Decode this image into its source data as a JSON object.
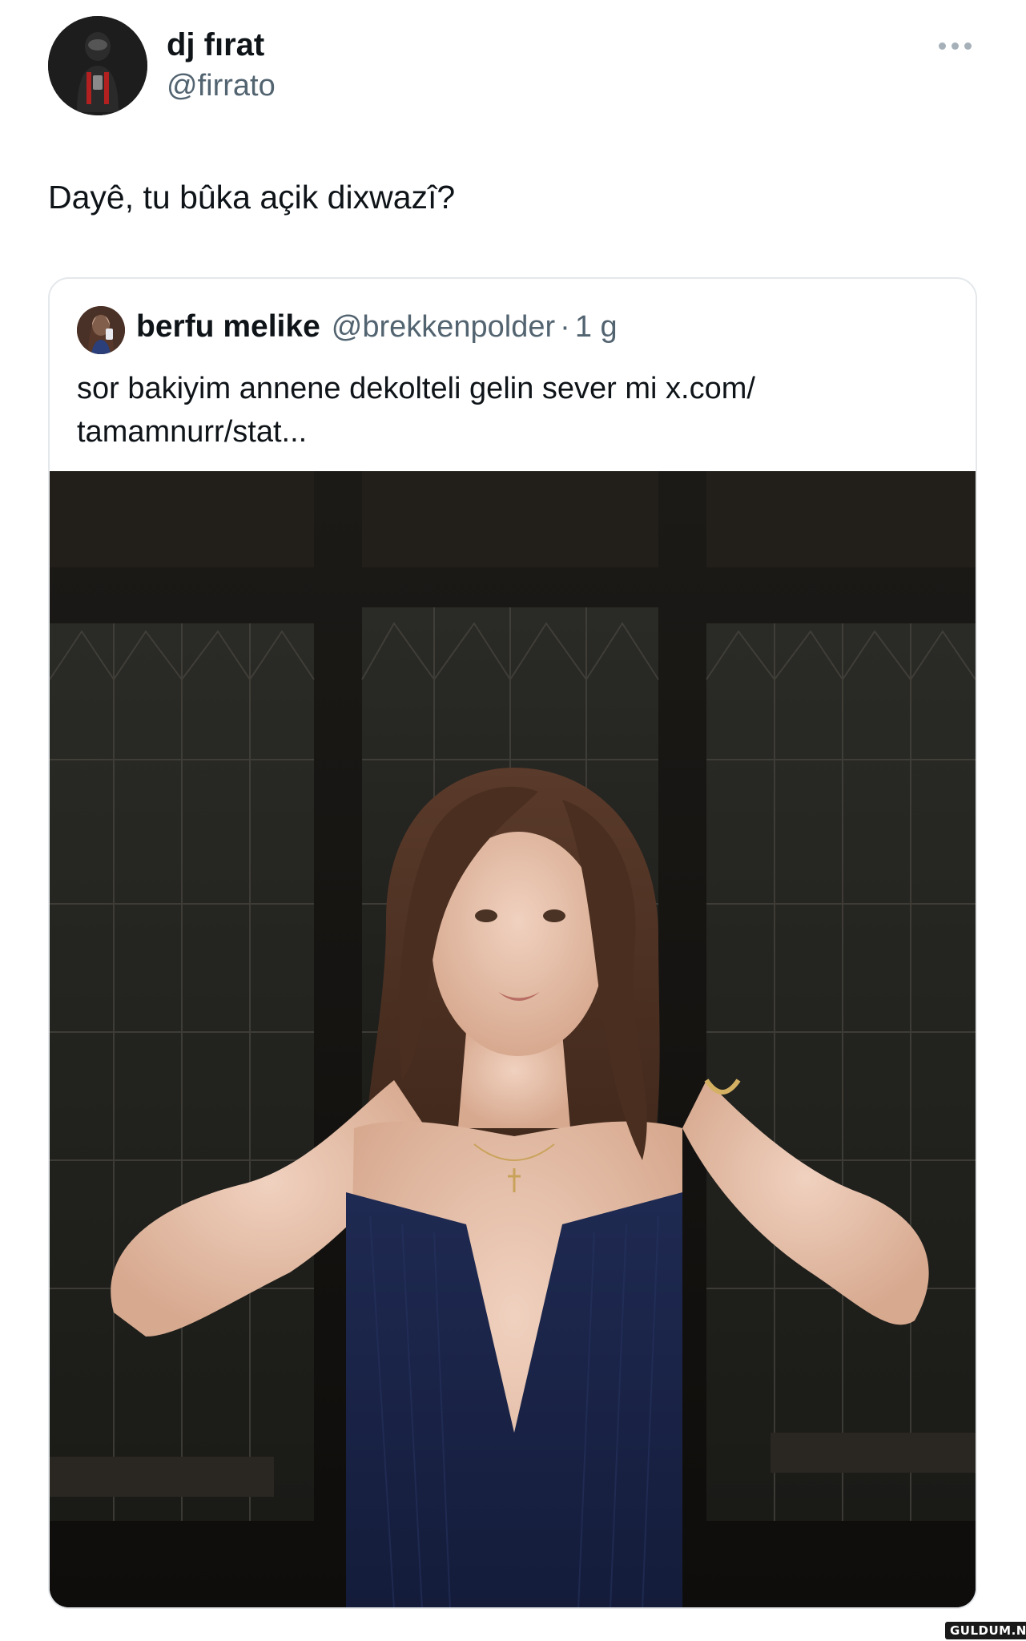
{
  "tweet": {
    "author": {
      "display_name": "dj fırat",
      "handle": "@firrato",
      "avatar_icon": "avatar-photo"
    },
    "text": "Dayê, tu bûka açik dixwazî?",
    "more_icon": "more-dots-icon"
  },
  "quoted_tweet": {
    "author": {
      "display_name": "berfu melike",
      "handle": "@brekkenpolder",
      "separator": "·",
      "time": "1 g",
      "avatar_icon": "avatar-photo"
    },
    "text_lines": [
      "sor bakiyim annene dekolteli gelin sever mi x.com/",
      "tamamnurr/stat..."
    ],
    "media": {
      "type": "photo"
    }
  },
  "watermark": "GULDUM.NET"
}
